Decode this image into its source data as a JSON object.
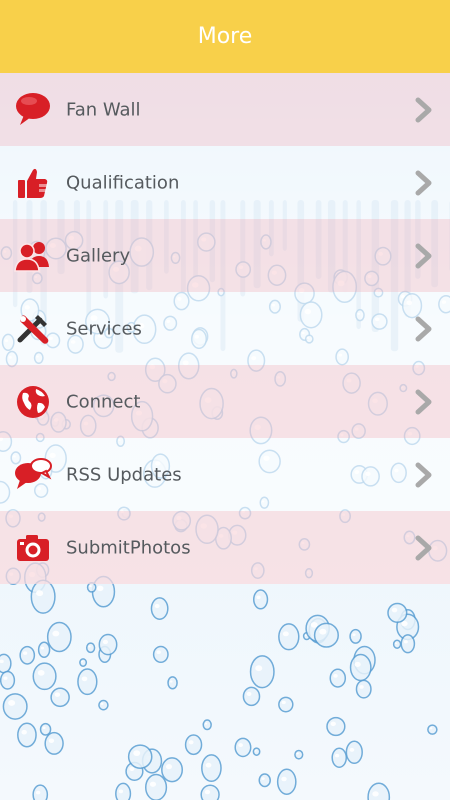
{
  "header": {
    "title": "More"
  },
  "menu": [
    {
      "label": "Fan Wall",
      "icon": "speech-bubble-icon"
    },
    {
      "label": "Qualification",
      "icon": "thumbs-up-icon"
    },
    {
      "label": "Gallery",
      "icon": "users-icon"
    },
    {
      "label": "Services",
      "icon": "tools-icon"
    },
    {
      "label": "Connect",
      "icon": "globe-icon"
    },
    {
      "label": "RSS Updates",
      "icon": "chat-bubbles-icon"
    },
    {
      "label": "SubmitPhotos",
      "icon": "camera-icon"
    }
  ],
  "colors": {
    "header_bg": "#f8d04a",
    "icon_red": "#d81f26",
    "chevron_gray": "#a9a9a9"
  }
}
